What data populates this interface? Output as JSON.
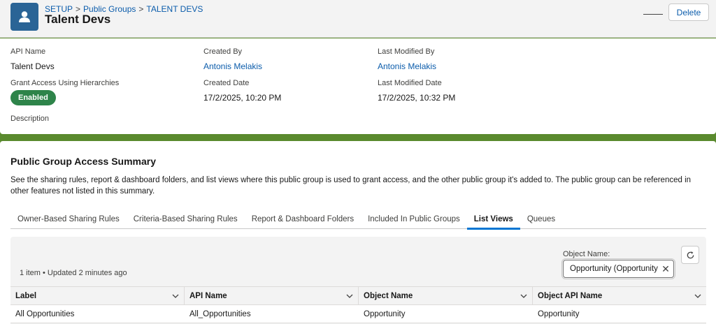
{
  "header": {
    "breadcrumb": [
      "SETUP",
      "Public Groups",
      "TALENT DEVS"
    ],
    "breadcrumb_separator": ">",
    "title": "Talent Devs",
    "delete_label": "Delete",
    "icon": "user-icon"
  },
  "details": {
    "api_name_label": "API Name",
    "api_name_value": "Talent Devs",
    "created_by_label": "Created By",
    "created_by_value": "Antonis Melakis",
    "last_modified_by_label": "Last Modified By",
    "last_modified_by_value": "Antonis Melakis",
    "grant_access_label": "Grant Access Using Hierarchies",
    "grant_access_value": "Enabled",
    "created_date_label": "Created Date",
    "created_date_value": "17/2/2025, 10:20 PM",
    "last_modified_date_label": "Last Modified Date",
    "last_modified_date_value": "17/2/2025, 10:32 PM",
    "description_label": "Description"
  },
  "summary": {
    "title": "Public Group Access Summary",
    "description": "See the sharing rules, report & dashboard folders, and list views where this public group is used to grant access, and the other public group it's added to. The public group can be referenced in other features not listed in this summary.",
    "tabs": [
      {
        "label": "Owner-Based Sharing Rules",
        "active": false
      },
      {
        "label": "Criteria-Based Sharing Rules",
        "active": false
      },
      {
        "label": "Report & Dashboard Folders",
        "active": false
      },
      {
        "label": "Included In Public Groups",
        "active": false
      },
      {
        "label": "List Views",
        "active": true
      },
      {
        "label": "Queues",
        "active": false
      }
    ]
  },
  "list_view": {
    "item_count": "1 item • Updated 2 minutes ago",
    "object_name_label": "Object Name:",
    "object_name_value": "Opportunity (Opportunity",
    "columns": [
      "Label",
      "API Name",
      "Object Name",
      "Object API Name"
    ],
    "rows": [
      [
        "All Opportunities",
        "All_Opportunities",
        "Opportunity",
        "Opportunity"
      ]
    ]
  },
  "colors": {
    "brand_blue": "#0b5cab",
    "success_green": "#2e844a",
    "background_green": "#5a8a2e",
    "active_tab": "#0176d3"
  }
}
